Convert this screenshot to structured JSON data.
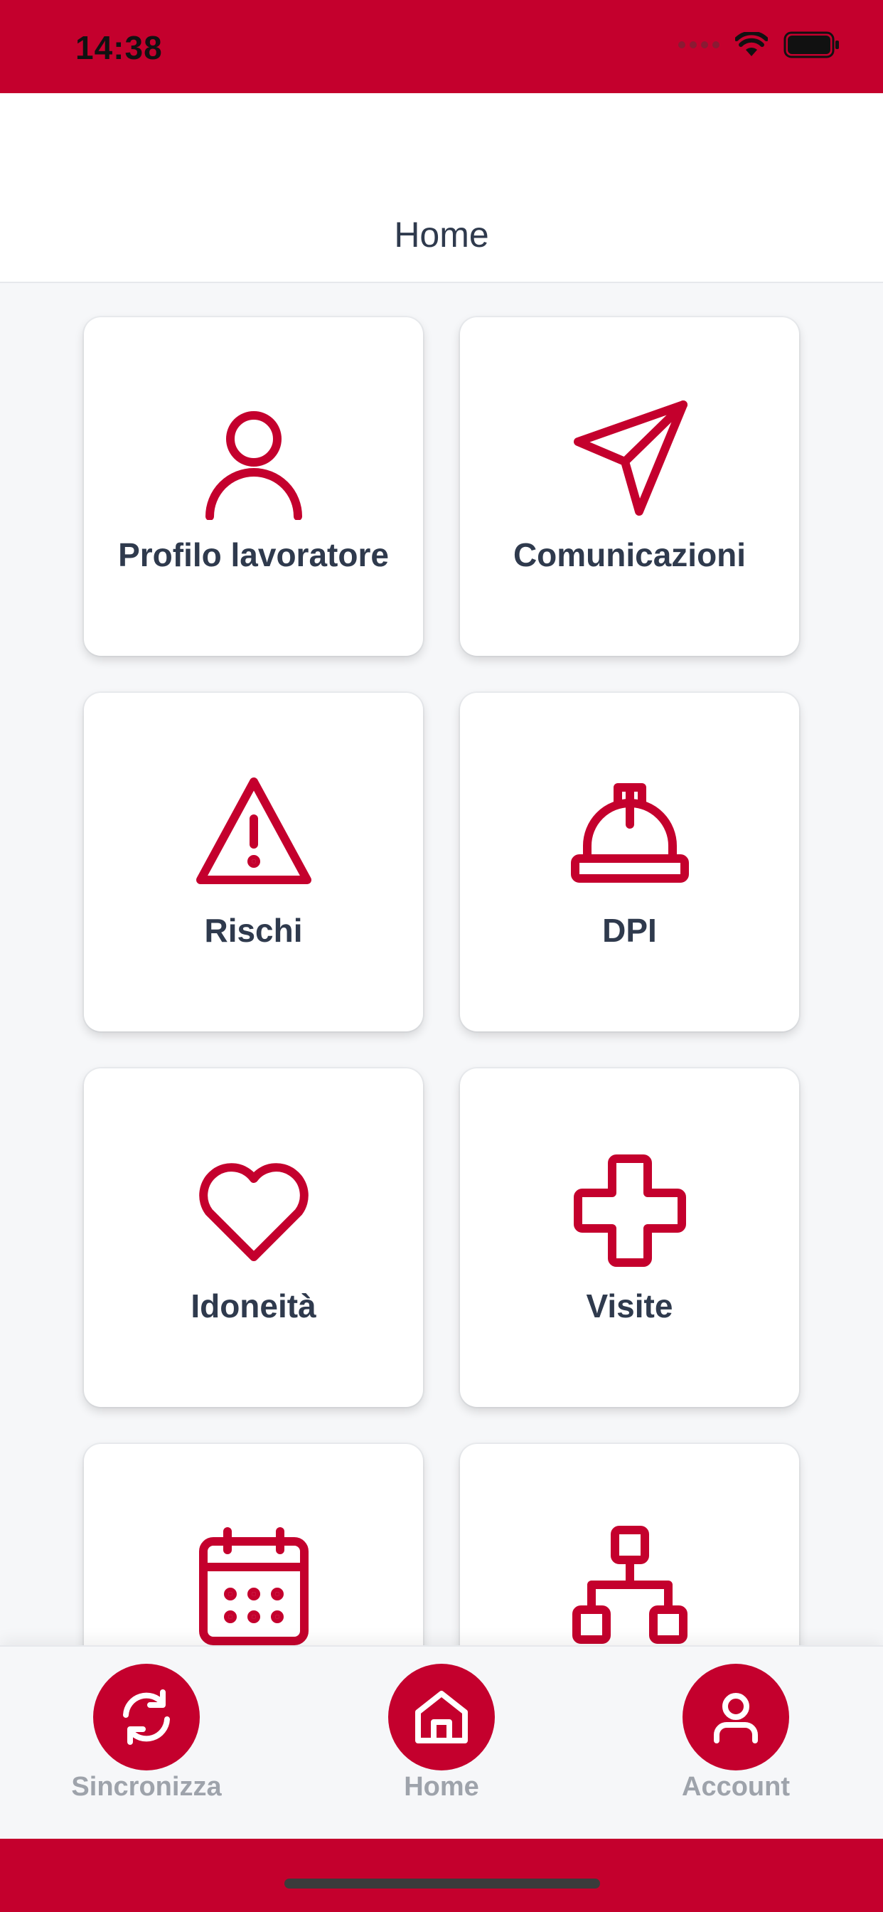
{
  "status_bar": {
    "time": "14:38"
  },
  "header": {
    "title": "Home"
  },
  "tiles": [
    {
      "label": "Profilo lavoratore",
      "icon": "user-icon"
    },
    {
      "label": "Comunicazioni",
      "icon": "paper-plane-icon"
    },
    {
      "label": "Rischi",
      "icon": "warning-triangle-icon"
    },
    {
      "label": "DPI",
      "icon": "hard-hat-icon"
    },
    {
      "label": "Idoneità",
      "icon": "heart-icon"
    },
    {
      "label": "Visite",
      "icon": "medical-cross-icon"
    },
    {
      "label": "",
      "icon": "calendar-icon"
    },
    {
      "label": "",
      "icon": "org-chart-icon"
    }
  ],
  "bottom_nav": {
    "sync_label": "Sincronizza",
    "home_label": "Home",
    "account_label": "Account"
  },
  "colors": {
    "accent": "#c4002d",
    "text": "#2f3a4d",
    "nav_label": "#9ea3ab"
  }
}
